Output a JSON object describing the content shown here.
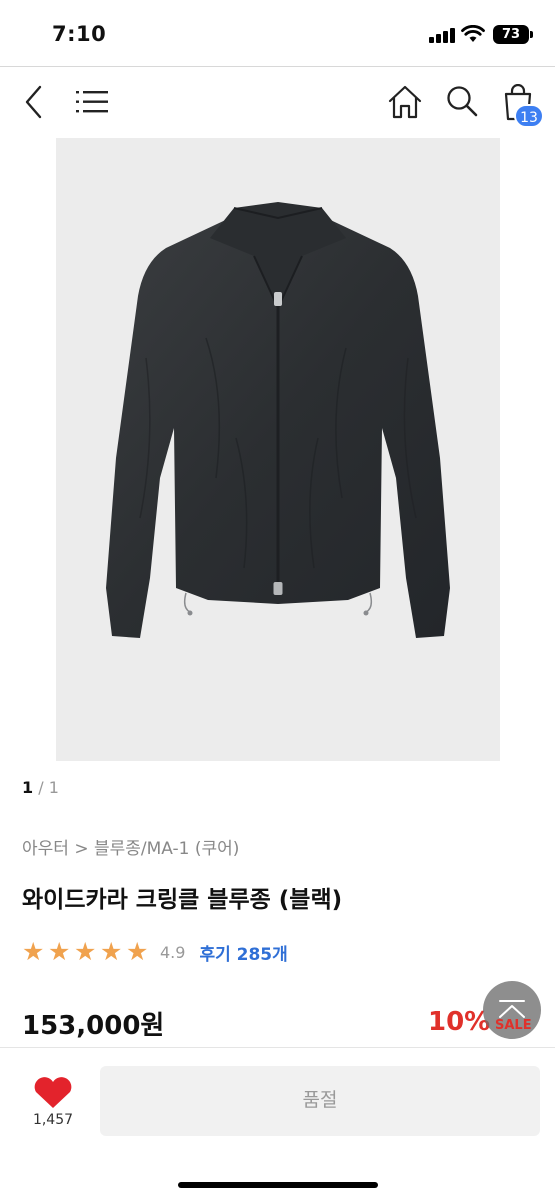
{
  "status_bar": {
    "time": "7:10",
    "battery": "73"
  },
  "nav": {
    "back_icon": "back-chevron-icon",
    "menu_icon": "hamburger-menu-icon",
    "home_icon": "home-icon",
    "search_icon": "search-icon",
    "bag_icon": "shopping-bag-icon",
    "cart_count": "13",
    "badge_color": "#3d7ff2"
  },
  "gallery": {
    "current": "1",
    "separator": " / ",
    "total": "1",
    "image_background": "#ececec"
  },
  "product": {
    "breadcrumb": "아우터 > 블루종/MA-1 (쿠어)",
    "title": "와이드카라 크링클 블루종 (블랙)",
    "stars": [
      "★",
      "★",
      "★",
      "★",
      "★"
    ],
    "rating": "4.9",
    "reviews": "후기 285개",
    "price": "153,000원",
    "discount": "10%",
    "sale_label": "SALE",
    "star_color": "#f0a24e",
    "discount_color": "#e0312b",
    "review_color": "#2f6fd6"
  },
  "bottom_bar": {
    "wish_count": "1,457",
    "soldout_label": "품절",
    "heart_color": "#e3232c"
  }
}
